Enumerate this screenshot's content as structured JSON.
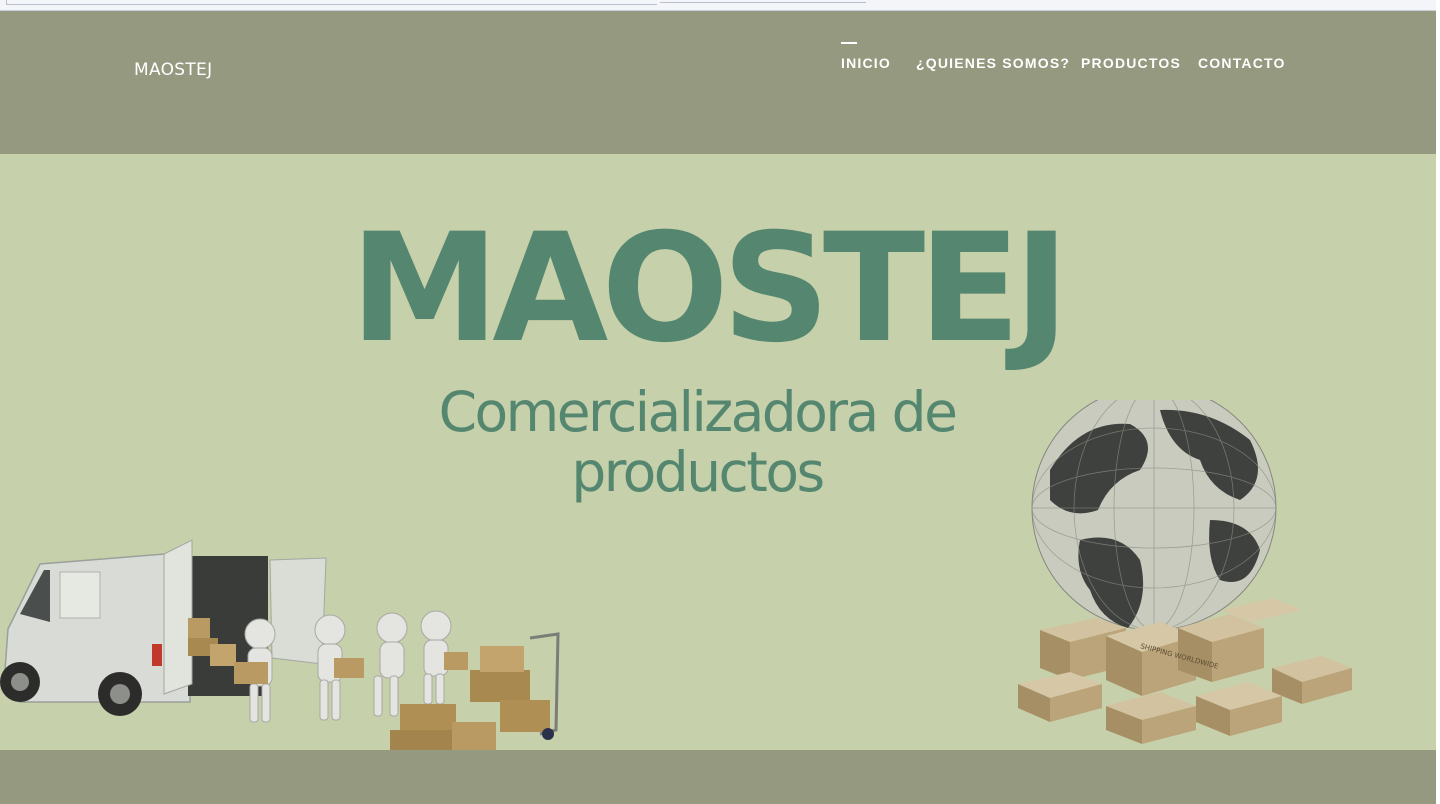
{
  "header": {
    "brand": "MAOSTEJ",
    "nav": [
      {
        "label": "INICIO",
        "active": true
      },
      {
        "label": "¿QUIENES SOMOS?",
        "active": false
      },
      {
        "label": "PRODUCTOS",
        "active": false
      },
      {
        "label": "CONTACTO",
        "active": false
      }
    ]
  },
  "hero": {
    "title": "MAOSTEJ",
    "subtitle": "Comercializadora de productos",
    "illustration_left": "delivery-van-with-figures-carrying-boxes",
    "illustration_right": "globe-on-shipping-boxes",
    "box_label": "SHIPPING WORLDWIDE"
  },
  "colors": {
    "header_bg": "#94997f",
    "hero_bg": "#c6d0aa",
    "accent_text": "#558770",
    "nav_text": "#ffffff"
  }
}
